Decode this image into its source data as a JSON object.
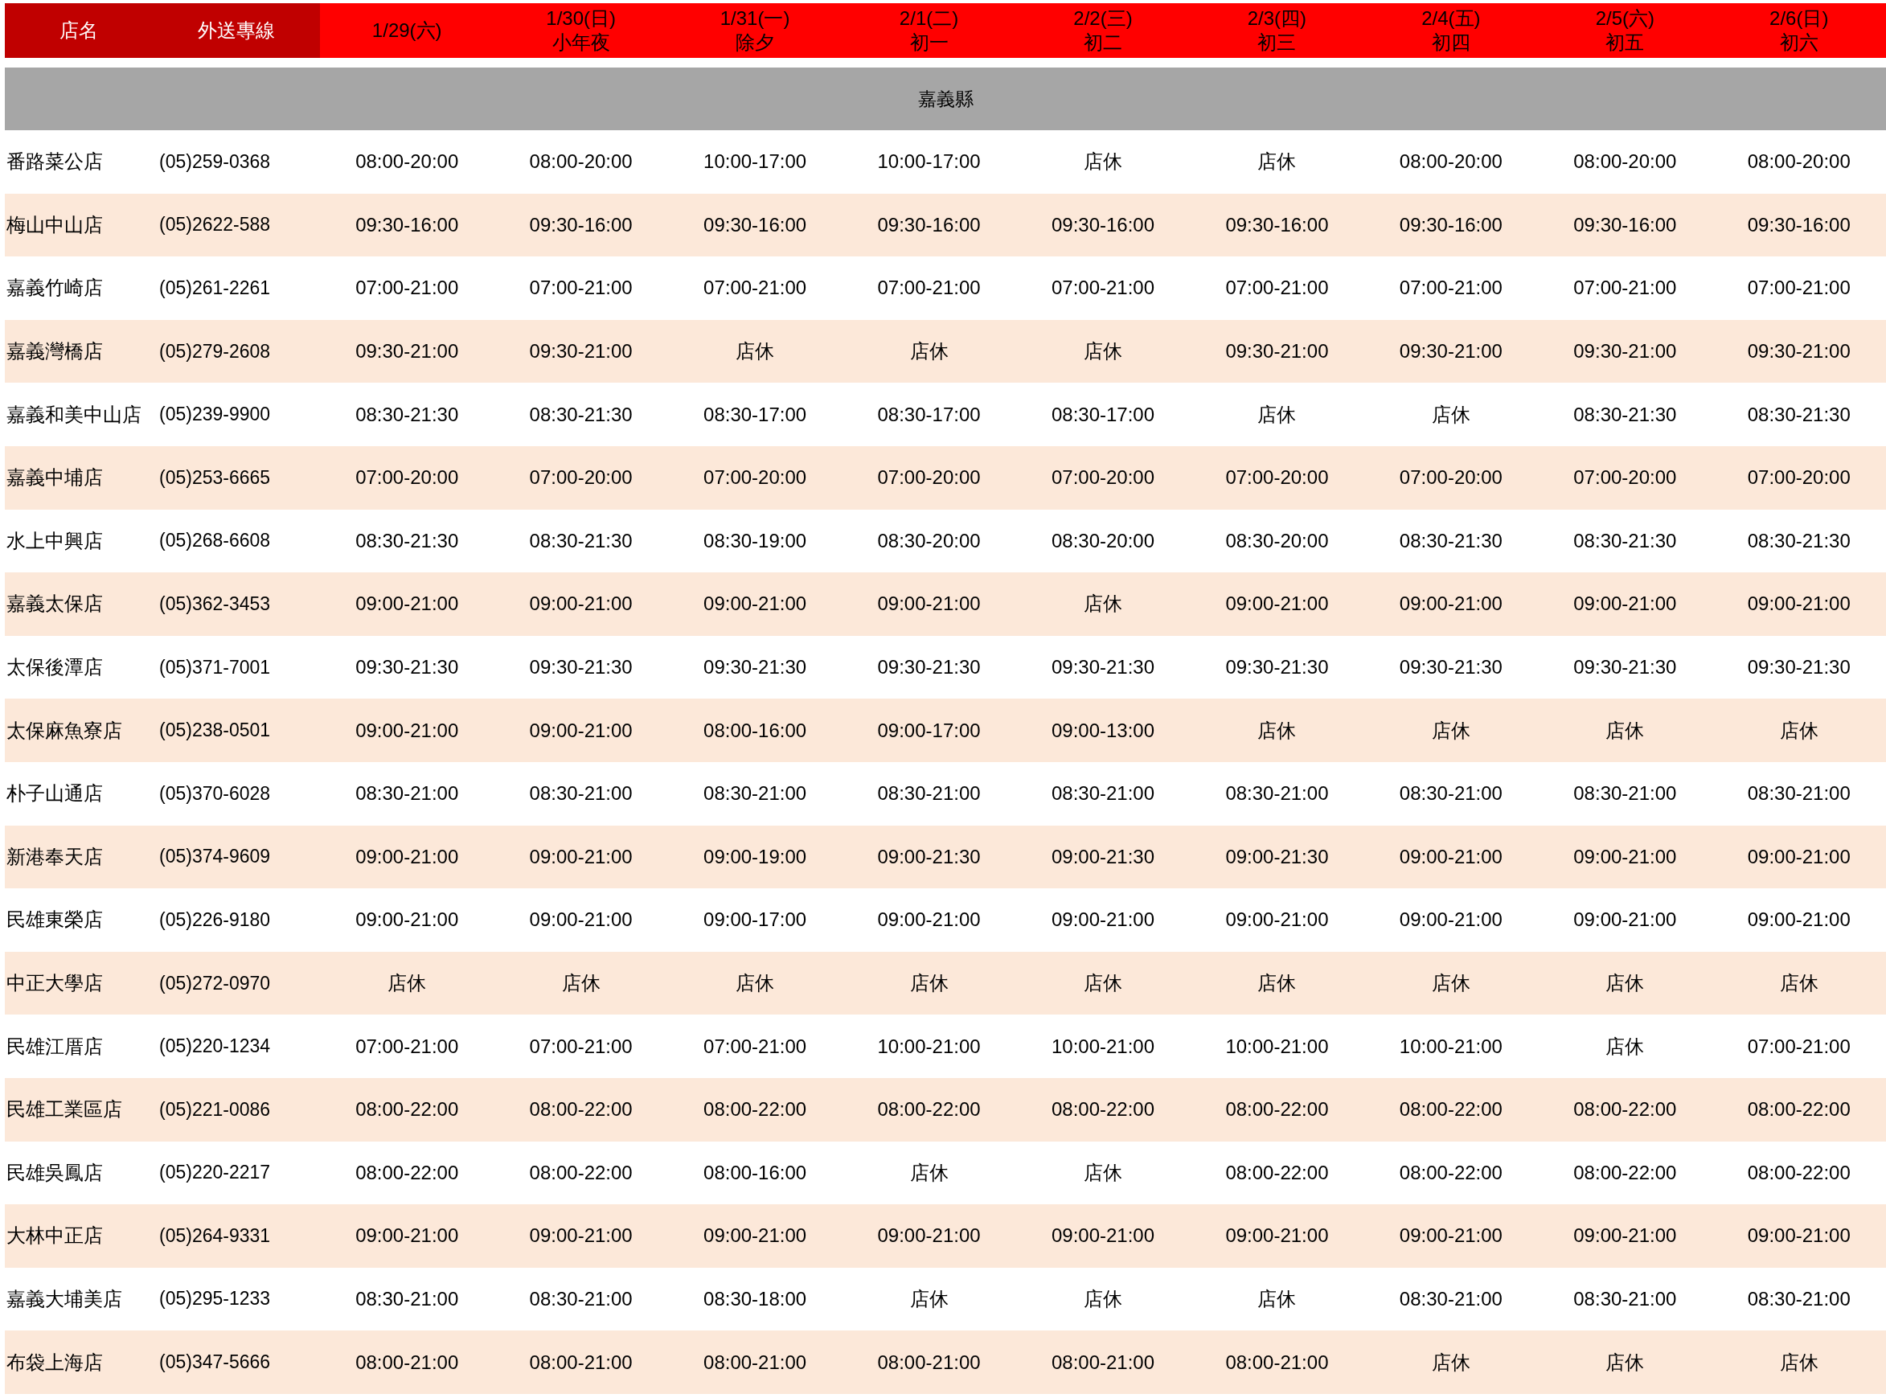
{
  "header": {
    "store_label": "店名",
    "phone_label": "外送專線",
    "dates": [
      {
        "date": "1/29(六)"
      },
      {
        "date": "1/30(日)",
        "note": "小年夜"
      },
      {
        "date": "1/31(一)",
        "note": "除夕"
      },
      {
        "date": "2/1(二)",
        "note": "初一"
      },
      {
        "date": "2/2(三)",
        "note": "初二"
      },
      {
        "date": "2/3(四)",
        "note": "初三"
      },
      {
        "date": "2/4(五)",
        "note": "初四"
      },
      {
        "date": "2/5(六)",
        "note": "初五"
      },
      {
        "date": "2/6(日)",
        "note": "初六"
      }
    ]
  },
  "section": "嘉義縣",
  "rows": [
    {
      "store": "番路菜公店",
      "phone": "(05)259-0368",
      "hours": [
        "08:00-20:00",
        "08:00-20:00",
        "10:00-17:00",
        "10:00-17:00",
        "店休",
        "店休",
        "08:00-20:00",
        "08:00-20:00",
        "08:00-20:00"
      ]
    },
    {
      "store": "梅山中山店",
      "phone": "(05)2622-588",
      "hours": [
        "09:30-16:00",
        "09:30-16:00",
        "09:30-16:00",
        "09:30-16:00",
        "09:30-16:00",
        "09:30-16:00",
        "09:30-16:00",
        "09:30-16:00",
        "09:30-16:00"
      ]
    },
    {
      "store": "嘉義竹崎店",
      "phone": "(05)261-2261",
      "hours": [
        "07:00-21:00",
        "07:00-21:00",
        "07:00-21:00",
        "07:00-21:00",
        "07:00-21:00",
        "07:00-21:00",
        "07:00-21:00",
        "07:00-21:00",
        "07:00-21:00"
      ]
    },
    {
      "store": "嘉義灣橋店",
      "phone": "(05)279-2608",
      "hours": [
        "09:30-21:00",
        "09:30-21:00",
        "店休",
        "店休",
        "店休",
        "09:30-21:00",
        "09:30-21:00",
        "09:30-21:00",
        "09:30-21:00"
      ]
    },
    {
      "store": "嘉義和美中山店",
      "phone": "(05)239-9900",
      "hours": [
        "08:30-21:30",
        "08:30-21:30",
        "08:30-17:00",
        "08:30-17:00",
        "08:30-17:00",
        "店休",
        "店休",
        "08:30-21:30",
        "08:30-21:30"
      ]
    },
    {
      "store": "嘉義中埔店",
      "phone": "(05)253-6665",
      "hours": [
        "07:00-20:00",
        "07:00-20:00",
        "07:00-20:00",
        "07:00-20:00",
        "07:00-20:00",
        "07:00-20:00",
        "07:00-20:00",
        "07:00-20:00",
        "07:00-20:00"
      ]
    },
    {
      "store": "水上中興店",
      "phone": "(05)268-6608",
      "hours": [
        "08:30-21:30",
        "08:30-21:30",
        "08:30-19:00",
        "08:30-20:00",
        "08:30-20:00",
        "08:30-20:00",
        "08:30-21:30",
        "08:30-21:30",
        "08:30-21:30"
      ]
    },
    {
      "store": "嘉義太保店",
      "phone": "(05)362-3453",
      "hours": [
        "09:00-21:00",
        "09:00-21:00",
        "09:00-21:00",
        "09:00-21:00",
        "店休",
        "09:00-21:00",
        "09:00-21:00",
        "09:00-21:00",
        "09:00-21:00"
      ]
    },
    {
      "store": "太保後潭店",
      "phone": "(05)371-7001",
      "hours": [
        "09:30-21:30",
        "09:30-21:30",
        "09:30-21:30",
        "09:30-21:30",
        "09:30-21:30",
        "09:30-21:30",
        "09:30-21:30",
        "09:30-21:30",
        "09:30-21:30"
      ]
    },
    {
      "store": "太保麻魚寮店",
      "phone": "(05)238-0501",
      "hours": [
        "09:00-21:00",
        "09:00-21:00",
        "08:00-16:00",
        "09:00-17:00",
        "09:00-13:00",
        "店休",
        "店休",
        "店休",
        "店休"
      ]
    },
    {
      "store": "朴子山通店",
      "phone": "(05)370-6028",
      "hours": [
        "08:30-21:00",
        "08:30-21:00",
        "08:30-21:00",
        "08:30-21:00",
        "08:30-21:00",
        "08:30-21:00",
        "08:30-21:00",
        "08:30-21:00",
        "08:30-21:00"
      ]
    },
    {
      "store": "新港奉天店",
      "phone": "(05)374-9609",
      "hours": [
        "09:00-21:00",
        "09:00-21:00",
        "09:00-19:00",
        "09:00-21:30",
        "09:00-21:30",
        "09:00-21:30",
        "09:00-21:00",
        "09:00-21:00",
        "09:00-21:00"
      ]
    },
    {
      "store": "民雄東榮店",
      "phone": "(05)226-9180",
      "hours": [
        "09:00-21:00",
        "09:00-21:00",
        "09:00-17:00",
        "09:00-21:00",
        "09:00-21:00",
        "09:00-21:00",
        "09:00-21:00",
        "09:00-21:00",
        "09:00-21:00"
      ]
    },
    {
      "store": "中正大學店",
      "phone": "(05)272-0970",
      "hours": [
        "店休",
        "店休",
        "店休",
        "店休",
        "店休",
        "店休",
        "店休",
        "店休",
        "店休"
      ]
    },
    {
      "store": "民雄江厝店",
      "phone": "(05)220-1234",
      "hours": [
        "07:00-21:00",
        "07:00-21:00",
        "07:00-21:00",
        "10:00-21:00",
        "10:00-21:00",
        "10:00-21:00",
        "10:00-21:00",
        "店休",
        "07:00-21:00"
      ]
    },
    {
      "store": "民雄工業區店",
      "phone": "(05)221-0086",
      "hours": [
        "08:00-22:00",
        "08:00-22:00",
        "08:00-22:00",
        "08:00-22:00",
        "08:00-22:00",
        "08:00-22:00",
        "08:00-22:00",
        "08:00-22:00",
        "08:00-22:00"
      ]
    },
    {
      "store": "民雄吳鳳店",
      "phone": "(05)220-2217",
      "hours": [
        "08:00-22:00",
        "08:00-22:00",
        "08:00-16:00",
        "店休",
        "店休",
        "08:00-22:00",
        "08:00-22:00",
        "08:00-22:00",
        "08:00-22:00"
      ]
    },
    {
      "store": "大林中正店",
      "phone": "(05)264-9331",
      "hours": [
        "09:00-21:00",
        "09:00-21:00",
        "09:00-21:00",
        "09:00-21:00",
        "09:00-21:00",
        "09:00-21:00",
        "09:00-21:00",
        "09:00-21:00",
        "09:00-21:00"
      ]
    },
    {
      "store": "嘉義大埔美店",
      "phone": "(05)295-1233",
      "hours": [
        "08:30-21:00",
        "08:30-21:00",
        "08:30-18:00",
        "店休",
        "店休",
        "店休",
        "08:30-21:00",
        "08:30-21:00",
        "08:30-21:00"
      ]
    },
    {
      "store": "布袋上海店",
      "phone": "(05)347-5666",
      "hours": [
        "08:00-21:00",
        "08:00-21:00",
        "08:00-21:00",
        "08:00-21:00",
        "08:00-21:00",
        "08:00-21:00",
        "店休",
        "店休",
        "店休"
      ]
    }
  ]
}
